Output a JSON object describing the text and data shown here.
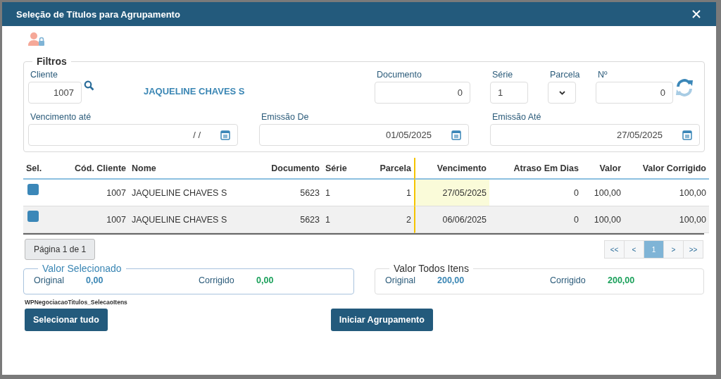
{
  "window": {
    "title": "Seleção de Títulos para Agrupamento"
  },
  "filters": {
    "legend": "Filtros",
    "cliente": {
      "label": "Cliente",
      "value": "1007",
      "name": "JAQUELINE CHAVES S"
    },
    "documento": {
      "label": "Documento",
      "value": "0"
    },
    "serie": {
      "label": "Série",
      "value": "1"
    },
    "parcela": {
      "label": "Parcela"
    },
    "numero": {
      "label": "Nº",
      "value": "0"
    },
    "vencimento_ate": {
      "label": "Vencimento até",
      "value": "/ /"
    },
    "emissao_de": {
      "label": "Emissão De",
      "value": "01/05/2025"
    },
    "emissao_ate": {
      "label": "Emissão Até",
      "value": "27/05/2025"
    }
  },
  "table": {
    "select_header": "Sel.",
    "columns": [
      "Cód. Cliente",
      "Nome",
      "Documento",
      "Série",
      "Parcela",
      "Vencimento",
      "Atraso Em Dias",
      "Valor",
      "Valor Corrigido"
    ],
    "rows": [
      {
        "checked": false,
        "focused": true,
        "cells": [
          "1007",
          "JAQUELINE CHAVES S",
          "5623",
          "1",
          "1",
          "27/05/2025",
          "0",
          "100,00",
          "100,00"
        ]
      },
      {
        "checked": false,
        "focused": false,
        "cells": [
          "1007",
          "JAQUELINE CHAVES S",
          "5623",
          "1",
          "2",
          "06/06/2025",
          "0",
          "100,00",
          "100,00"
        ]
      }
    ]
  },
  "page_info": "Página 1 de 1",
  "pager": [
    {
      "label": "<<",
      "selected": false
    },
    {
      "label": "<",
      "selected": false
    },
    {
      "label": "1",
      "selected": true
    },
    {
      "label": ">",
      "selected": false
    },
    {
      "label": ">>",
      "selected": false
    }
  ],
  "selected_total": {
    "legend": "Valor Selecionado",
    "original_label": "Original",
    "original": "0,00",
    "corrigido_label": "Corrigido",
    "corrigido": "0,00"
  },
  "all_total": {
    "legend": "Valor Todos Itens",
    "original_label": "Original",
    "original": "200,00",
    "corrigido_label": "Corrigido",
    "corrigido": "200,00"
  },
  "component_name": "WPNegociacaoTitulos_SelecaoItens",
  "buttons": [
    "Selecionar tudo",
    "Iniciar Agrupamento"
  ]
}
